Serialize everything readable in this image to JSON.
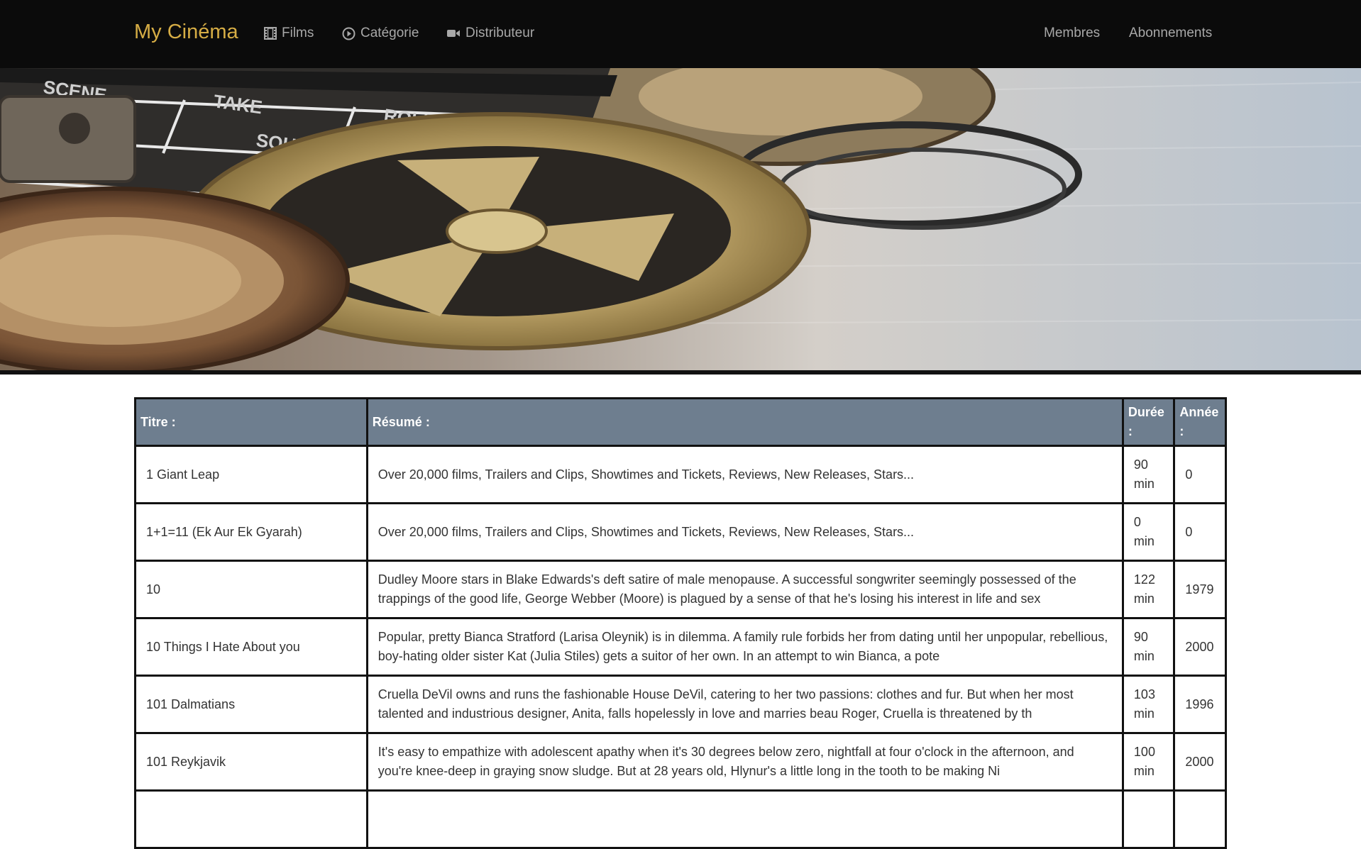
{
  "navbar": {
    "brand": "My Cinéma",
    "links": [
      {
        "label": "Films",
        "icon": "film-icon"
      },
      {
        "label": "Catégorie",
        "icon": "play-circle-icon"
      },
      {
        "label": "Distributeur",
        "icon": "video-camera-icon"
      }
    ],
    "right_links": [
      {
        "label": "Membres"
      },
      {
        "label": "Abonnements"
      }
    ],
    "colors": {
      "background": "#0b0b0b",
      "brand": "#d6ad45",
      "link": "#a8a8a8"
    }
  },
  "hero": {
    "image": "film-reels-and-clapperboard-banner",
    "clapper_words": [
      "SCENE",
      "TAKE",
      "ROLL",
      "SOUND"
    ]
  },
  "table": {
    "headers": {
      "titre": "Titre :",
      "resume": "Résumé :",
      "duree": "Durée :",
      "annee": "Année :"
    },
    "header_color": "#6e7e8f",
    "rows": [
      {
        "titre": "1 Giant Leap",
        "resume": "Over 20,000 films, Trailers and Clips, Showtimes and Tickets, Reviews, New Releases, Stars...",
        "duree": "90 min",
        "annee": "0"
      },
      {
        "titre": "1+1=11 (Ek Aur Ek Gyarah)",
        "resume": "Over 20,000 films, Trailers and Clips, Showtimes and Tickets, Reviews, New Releases, Stars...",
        "duree": "0 min",
        "annee": "0"
      },
      {
        "titre": "10",
        "resume": "Dudley Moore stars in Blake Edwards's deft satire of male menopause. A successful songwriter seemingly possessed of the trappings of the good life, George Webber (Moore) is plagued by a sense of that he's losing his interest in life and sex",
        "duree": "122 min",
        "annee": "1979"
      },
      {
        "titre": "10 Things I Hate About you",
        "resume": "Popular, pretty Bianca Stratford (Larisa Oleynik) is in dilemma. A family rule forbids her from dating until her unpopular, rebellious, boy-hating older sister Kat (Julia Stiles) gets a suitor of her own. In an attempt to win Bianca, a pote",
        "duree": "90 min",
        "annee": "2000"
      },
      {
        "titre": "101 Dalmatians",
        "resume": "Cruella DeVil owns and runs the fashionable House DeVil, catering to her two passions: clothes and fur. But when her most talented and industrious designer, Anita, falls hopelessly in love and marries beau Roger, Cruella is threatened by th",
        "duree": "103 min",
        "annee": "1996"
      },
      {
        "titre": "101 Reykjavik",
        "resume": "It's easy to empathize with adolescent apathy when it's 30 degrees below zero, nightfall at four o'clock in the afternoon, and you're knee-deep in graying snow sludge. But at 28 years old, Hlynur's a little long in the tooth to be making Ni",
        "duree": "100 min",
        "annee": "2000"
      },
      {
        "titre": "",
        "resume": "",
        "duree": "",
        "annee": ""
      }
    ]
  }
}
